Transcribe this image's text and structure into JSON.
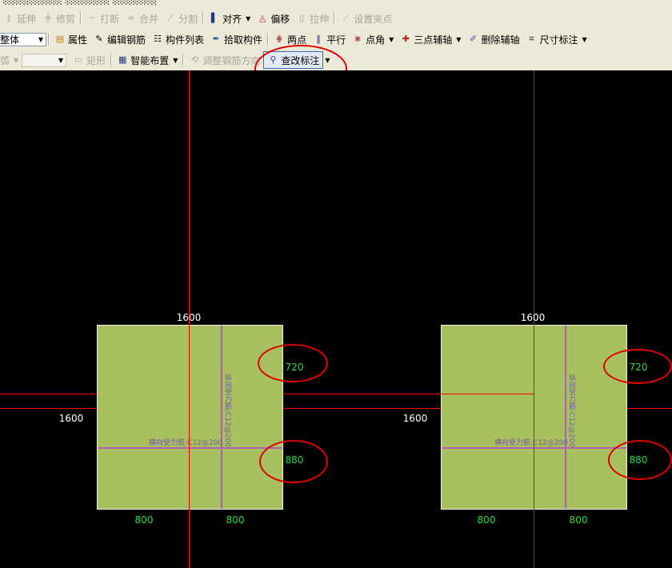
{
  "toolbar_row0": {
    "items": [
      "延伸",
      "修剪",
      "打断",
      "合并",
      "分割",
      "对齐",
      "偏移",
      "拉伸",
      "设置夹点"
    ]
  },
  "toolbar_row1": {
    "combo_value": "整体",
    "items": [
      "属性",
      "编辑钢筋",
      "构件列表",
      "拾取构件",
      "两点",
      "平行",
      "点角",
      "三点辅轴",
      "删除辅轴",
      "尺寸标注"
    ]
  },
  "toolbar_row2": {
    "arc_label": "弧",
    "rect_label": "矩形",
    "smart_layout": "智能布置",
    "adjust_direction": "调整钢筋方向",
    "query_annotation": "查改标注"
  },
  "canvas": {
    "slabs": [
      {
        "top_dim": "1600",
        "left_dim": "1600",
        "right_dims": [
          "720",
          "880"
        ],
        "bottom_dims": [
          "800",
          "800"
        ],
        "horizontal_rebar": "横向受力筋:C12@200",
        "vertical_rebar": "纵向受力筋:C12@200"
      },
      {
        "top_dim": "1600",
        "left_dim": "1600",
        "right_dims": [
          "720",
          "880"
        ],
        "bottom_dims": [
          "800",
          "800"
        ],
        "horizontal_rebar": "横向受力筋:C12@200",
        "vertical_rebar": "纵向受力筋:C12@200"
      }
    ]
  },
  "colors": {
    "slab_fill": "#a8c060",
    "dimension_green": "#22dd44",
    "axis_red": "#ff0000",
    "annotation_ellipse": "#e00000",
    "rebar": "#b060b0"
  }
}
